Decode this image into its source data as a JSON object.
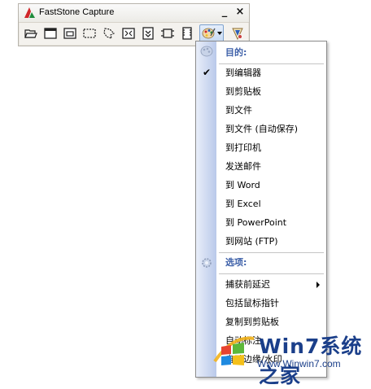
{
  "window": {
    "title": "FastStone Capture",
    "minimize_label": "_",
    "close_label": "×"
  },
  "toolbar": {
    "tools": [
      {
        "icon": "open-folder-icon"
      },
      {
        "icon": "capture-window-icon"
      },
      {
        "icon": "capture-object-icon"
      },
      {
        "icon": "capture-rectangle-icon"
      },
      {
        "icon": "capture-freehand-icon"
      },
      {
        "icon": "capture-fullscreen-icon"
      },
      {
        "icon": "capture-scrolling-icon"
      },
      {
        "icon": "capture-fixed-region-icon"
      },
      {
        "icon": "screen-recorder-icon"
      },
      {
        "icon": "output-palette-icon"
      },
      {
        "icon": "settings-icon"
      }
    ]
  },
  "menu": {
    "target_header": "目的:",
    "items": [
      {
        "label": "到编辑器",
        "checked": true
      },
      {
        "label": "到剪贴板",
        "checked": false
      },
      {
        "label": "到文件",
        "checked": false
      },
      {
        "label": "到文件 (自动保存)",
        "checked": false
      },
      {
        "label": "到打印机",
        "checked": false
      },
      {
        "label": "发送邮件",
        "checked": false
      },
      {
        "label": "到 Word",
        "checked": false
      },
      {
        "label": "到 Excel",
        "checked": false
      },
      {
        "label": "到 PowerPoint",
        "checked": false
      },
      {
        "label": "到网站 (FTP)",
        "checked": false
      }
    ],
    "options_header": "选项:",
    "options": [
      {
        "label": "捕获前延迟",
        "submenu": true
      },
      {
        "label": "包括鼠标指针",
        "submenu": false
      },
      {
        "label": "复制到剪贴板",
        "submenu": false
      },
      {
        "label": "自动标注",
        "submenu": false
      },
      {
        "label": "自动边缘/水印",
        "submenu": false
      }
    ]
  },
  "watermark": {
    "brand": "Win7系统之家",
    "url": "Www.Winwin7.com"
  },
  "colors": {
    "header_text": "#3c5fa8",
    "menu_strip": "#b9c9ea",
    "watermark": "#1b3f8a"
  }
}
